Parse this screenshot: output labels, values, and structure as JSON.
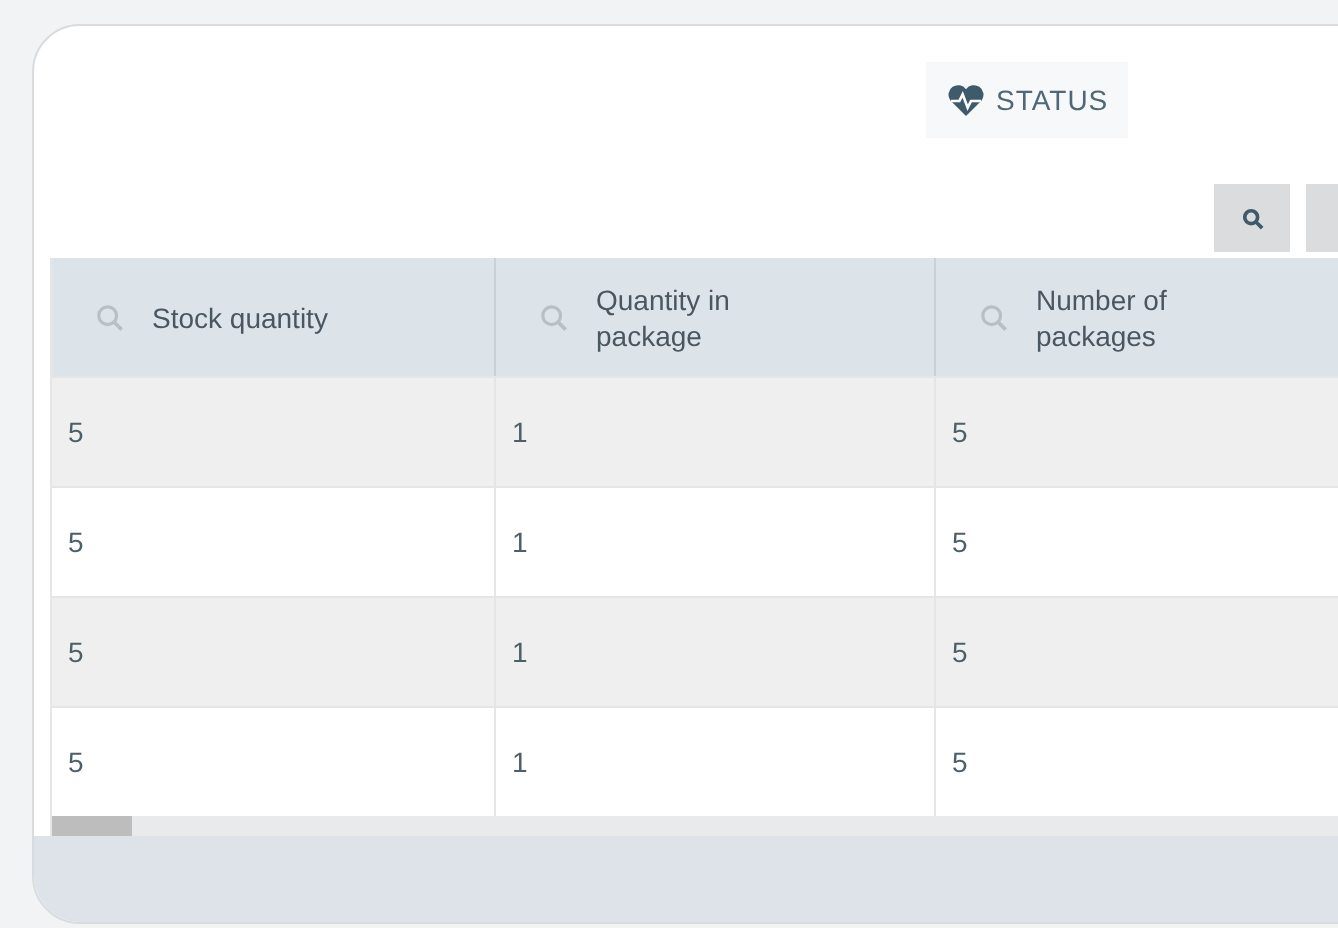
{
  "status_button": {
    "label": "STATUS"
  },
  "toolbar": {
    "buttons": [
      {
        "kind": "search"
      },
      {
        "kind": "other"
      }
    ]
  },
  "table": {
    "columns": [
      {
        "label": "Stock quantity"
      },
      {
        "label": "Quantity in package"
      },
      {
        "label": "Number of packages"
      }
    ],
    "rows": [
      [
        "5",
        "1",
        "5"
      ],
      [
        "5",
        "1",
        "5"
      ],
      [
        "5",
        "1",
        "5"
      ],
      [
        "5",
        "1",
        "5"
      ]
    ]
  }
}
